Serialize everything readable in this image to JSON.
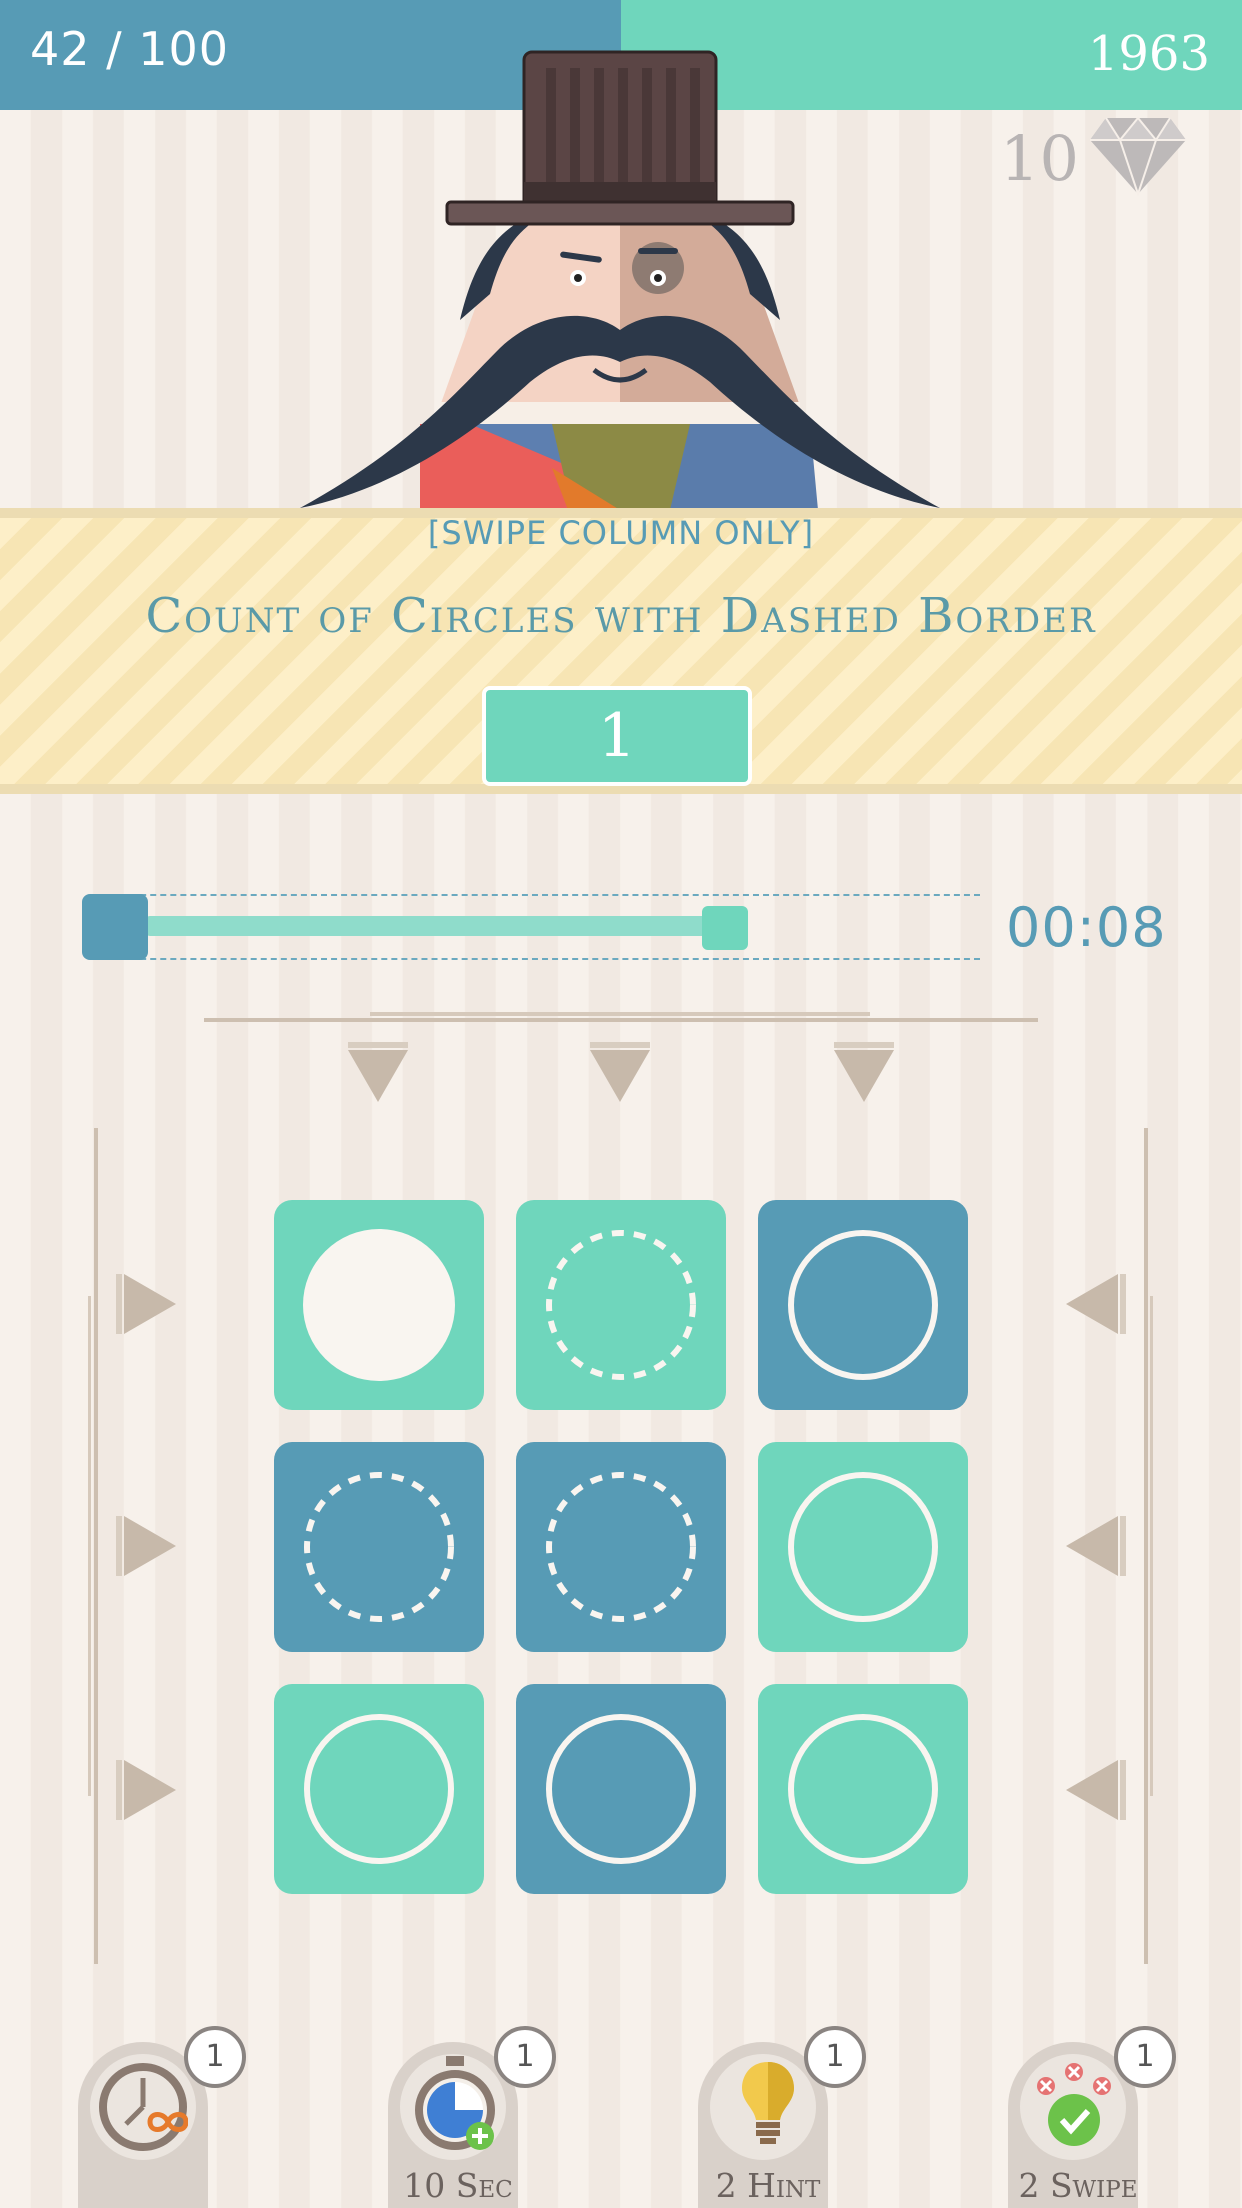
{
  "header": {
    "level_progress": "42 / 100",
    "score": "1963",
    "gems": "10"
  },
  "rule": {
    "hint": "[SWIPE COLUMN ONLY]",
    "title": "Count of Circles with Dashed Border",
    "answer": "1"
  },
  "timer": {
    "time": "00:08",
    "remaining_fraction": 0.74
  },
  "grid": {
    "rows": [
      [
        {
          "bg": "green",
          "circle": "filled-white"
        },
        {
          "bg": "green",
          "circle": "dashed"
        },
        {
          "bg": "blue",
          "circle": "solid"
        }
      ],
      [
        {
          "bg": "blue",
          "circle": "dashed"
        },
        {
          "bg": "blue",
          "circle": "dashed"
        },
        {
          "bg": "green",
          "circle": "solid"
        }
      ],
      [
        {
          "bg": "green",
          "circle": "solid"
        },
        {
          "bg": "blue",
          "circle": "solid"
        },
        {
          "bg": "green",
          "circle": "solid"
        }
      ]
    ]
  },
  "powerups": [
    {
      "label": "",
      "count": "1",
      "icon": "infinite-time-icon"
    },
    {
      "label": "10 Sec",
      "count": "1",
      "icon": "stopwatch-plus-icon"
    },
    {
      "label": "2 Hint",
      "count": "1",
      "icon": "lightbulb-icon"
    },
    {
      "label": "2 Swipe",
      "count": "1",
      "icon": "swipe-check-icon"
    }
  ],
  "colors": {
    "blue": "#579bb5",
    "green": "#6fd6bc",
    "banner": "#fdeec6",
    "rail": "#cdbfb0"
  }
}
